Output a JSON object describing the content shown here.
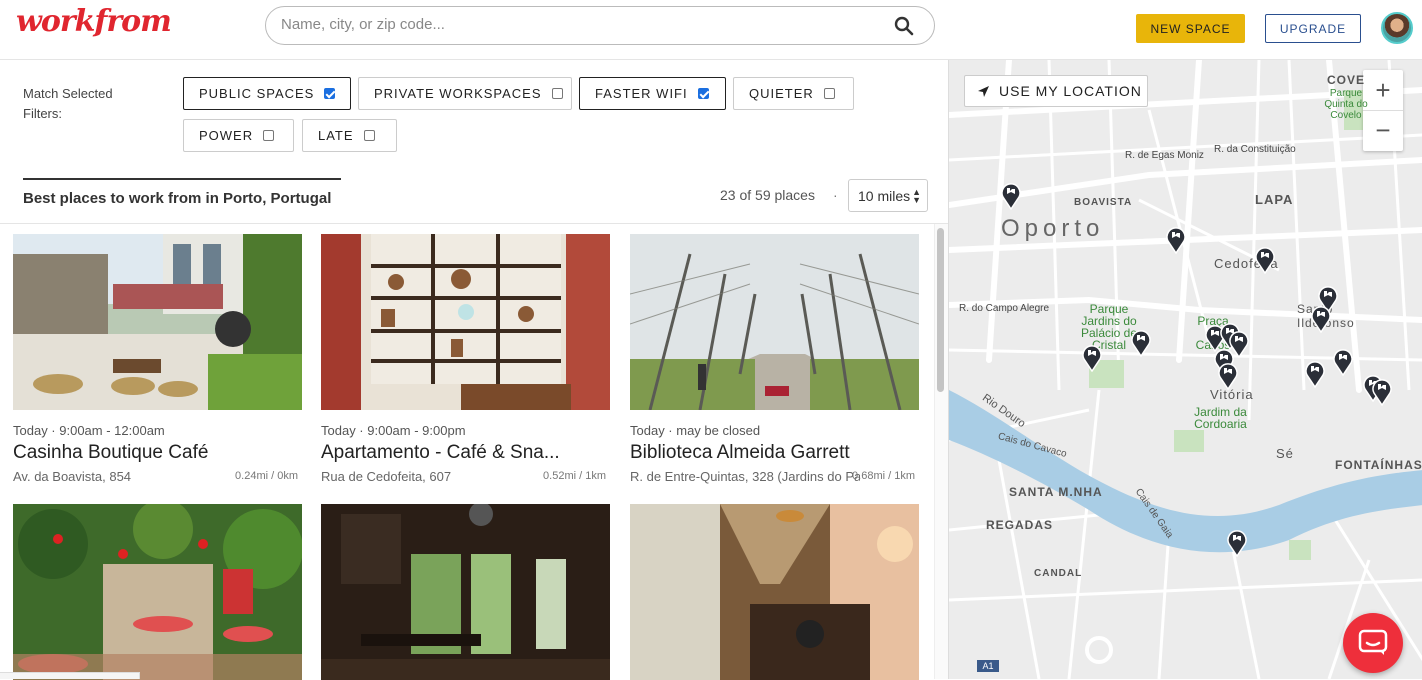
{
  "header": {
    "logo": "workfrom",
    "search_placeholder": "Name, city, or zip code...",
    "new_space_label": "NEW SPACE",
    "upgrade_label": "UPGRADE"
  },
  "filters": {
    "label": "Match Selected Filters:",
    "chips": [
      {
        "label": "PUBLIC SPACES",
        "checked": true
      },
      {
        "label": "PRIVATE WORKSPACES",
        "checked": false
      },
      {
        "label": "FASTER WIFI",
        "checked": true
      },
      {
        "label": "QUIETER",
        "checked": false
      },
      {
        "label": "POWER",
        "checked": false
      },
      {
        "label": "LATE",
        "checked": false
      }
    ]
  },
  "list": {
    "title": "Best places to work from in Porto, Portugal",
    "count": "23 of 59 places",
    "separator": "·",
    "radius": "10 miles"
  },
  "cards": [
    {
      "hours": "Today · 9:00am - 12:00am",
      "name": "Casinha Boutique Café",
      "address": "Av. da Boavista, 854",
      "distance": "0.24mi / 0km"
    },
    {
      "hours": "Today · 9:00am - 9:00pm",
      "name": "Apartamento - Café & Sna...",
      "address": "Rua de Cedofeita, 607",
      "distance": "0.52mi / 1km"
    },
    {
      "hours": "Today · may be closed",
      "name": "Biblioteca Almeida Garrett",
      "address": "R. de Entre-Quintas, 328 (Jardins do Pa...",
      "distance": "0.68mi / 1km"
    }
  ],
  "map": {
    "use_location_label": "USE MY LOCATION",
    "zoom_in": "+",
    "zoom_out": "−",
    "labels": {
      "oporto": "Oporto",
      "boavista": "BOAVISTA",
      "lapa": "LAPA",
      "cedofeita": "Cedofeita",
      "santo_ildefonso": "Santo Ildefonso",
      "vitoria": "Vitória",
      "se": "Sé",
      "fontainhas": "FONTAÍNHAS",
      "santa_marinha": "SANTA M.NHA",
      "regadas": "REGADAS",
      "candal": "CANDAL",
      "cove": "COVE",
      "egas_moniz": "R. de Egas Moniz",
      "constituicao": "R. da Constituição",
      "campo_alegre": "R. do Campo Alegre",
      "parque": "Parque Jardins do Palácio de Cristal",
      "praca": "Praça de Carlos",
      "jardim": "Jardim da Cordoaria",
      "rio_douro": "Rio Douro",
      "cais_cavaco": "Cais do Cavaco",
      "cais_gaia": "Cais de Gaia",
      "quinta": "Parque Quinta do Covelo",
      "a1": "A1"
    }
  },
  "colors": {
    "brand_red": "#e0262f",
    "new_space_yellow": "#e8b50a",
    "upgrade_blue": "#2a4f8f",
    "river": "#a9cde5",
    "chat_red": "#ee2f3b"
  }
}
